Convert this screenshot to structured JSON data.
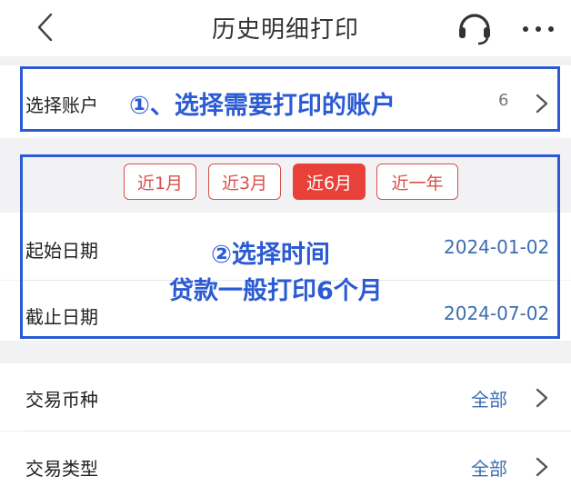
{
  "header": {
    "title": "历史明细打印"
  },
  "account": {
    "label": "选择账户",
    "value_suffix": "6",
    "annotation": "①、选择需要打印的账户"
  },
  "period": {
    "chips": [
      {
        "label": "近1月",
        "active": false
      },
      {
        "label": "近3月",
        "active": false
      },
      {
        "label": "近6月",
        "active": true
      },
      {
        "label": "近一年",
        "active": false
      }
    ],
    "start_label": "起始日期",
    "start_value": "2024-01-02",
    "end_label": "截止日期",
    "end_value": "2024-07-02",
    "annotation_line1": "②选择时间",
    "annotation_line2": "贷款一般打印6个月"
  },
  "currency": {
    "label": "交易币种",
    "value": "全部"
  },
  "tx_type": {
    "label": "交易类型",
    "value": "全部"
  },
  "colors": {
    "accent_red": "#e8413a",
    "annotation_blue": "#2b5bd3",
    "value_blue": "#3b6db3"
  },
  "icons": [
    "chevron-left-icon",
    "headset-icon",
    "more-icon",
    "chevron-right-icon"
  ]
}
